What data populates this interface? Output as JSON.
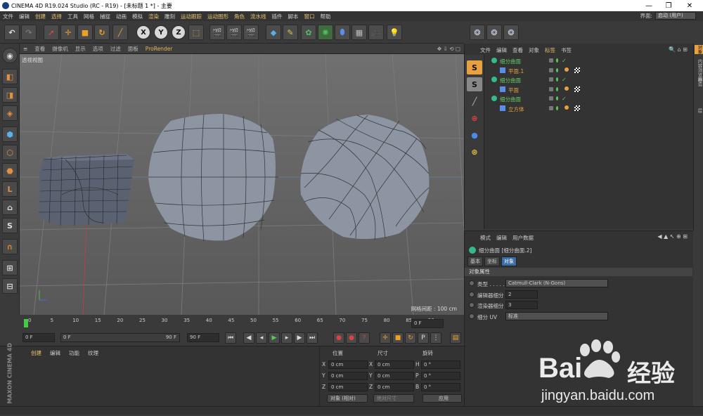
{
  "window": {
    "title": "CINEMA 4D R19.024 Studio (RC - R19) - [未标题 1 *] - 主要"
  },
  "window_controls": {
    "minimize": "—",
    "maximize": "❐",
    "close": "✕"
  },
  "menubar": [
    "文件",
    "编辑",
    "创建",
    "选择",
    "工具",
    "网格",
    "捕捉",
    "动画",
    "模拟",
    "渲染",
    "雕刻",
    "运动跟踪",
    "运动图形",
    "角色",
    "流水线",
    "插件",
    "脚本",
    "窗口",
    "帮助"
  ],
  "layout": {
    "label": "界面:",
    "value": "启动 (用户)"
  },
  "toolbar": {
    "axis_x": "X",
    "axis_y": "Y",
    "axis_z": "Z"
  },
  "viewport": {
    "menu": [
      "查看",
      "摄像机",
      "显示",
      "选项",
      "过滤",
      "面板",
      "ProRender"
    ],
    "title": "透视视图",
    "grid_label": "网格间距 : 100 cm"
  },
  "timeline": {
    "ticks": [
      "0",
      "5",
      "10",
      "15",
      "20",
      "25",
      "30",
      "35",
      "40",
      "45",
      "50",
      "55",
      "60",
      "65",
      "70",
      "75",
      "80",
      "85",
      "90"
    ],
    "frame_field": "0 F",
    "start_field": "0 F",
    "min_field": "0 F",
    "max_field": "90 F",
    "end_field": "90 F"
  },
  "materials": {
    "menu": [
      "创建",
      "编辑",
      "功能",
      "纹理"
    ]
  },
  "coords": {
    "headers": [
      "位置",
      "尺寸",
      "旋转"
    ],
    "rows": [
      {
        "pos_label": "X",
        "pos": "0 cm",
        "size_label": "X",
        "size": "0 cm",
        "rot_label": "H",
        "rot": "0 °"
      },
      {
        "pos_label": "Y",
        "pos": "0 cm",
        "size_label": "Y",
        "size": "0 cm",
        "rot_label": "P",
        "rot": "0 °"
      },
      {
        "pos_label": "Z",
        "pos": "0 cm",
        "size_label": "Z",
        "size": "0 cm",
        "rot_label": "B",
        "rot": "0 °"
      }
    ],
    "mode_select": "对象 (相对)",
    "size_select": "绝对尺寸",
    "apply_button": "应用"
  },
  "brand": {
    "maxon": "MAXON CINEMA 4D"
  },
  "object_manager": {
    "menu": [
      "文件",
      "编辑",
      "查看",
      "对象",
      "标签",
      "书签"
    ],
    "objects": [
      {
        "name": "细分曲面",
        "level": 0
      },
      {
        "name": "平面.1",
        "level": 1
      },
      {
        "name": "细分曲面",
        "level": 0
      },
      {
        "name": "平面",
        "level": 1
      },
      {
        "name": "细分曲面",
        "level": 0
      },
      {
        "name": "立方体",
        "level": 1
      }
    ]
  },
  "right_tabs": [
    "对象",
    "内容浏览器",
    "构造",
    "层"
  ],
  "attributes": {
    "menu": [
      "模式",
      "编辑",
      "用户数据"
    ],
    "object_name": "细分曲面 [细分曲面.2]",
    "tabs": [
      "基本",
      "坐标",
      "对象"
    ],
    "section": "对象属性",
    "rows": [
      {
        "label": "类型 . . . . . . .",
        "value": "Catmull-Clark (N-Gons)"
      },
      {
        "label": "编辑器细分",
        "value": "2"
      },
      {
        "label": "渲染器细分",
        "value": "3"
      },
      {
        "label": "细分 UV",
        "value": "标准"
      }
    ]
  },
  "watermark": {
    "brand": "Bai",
    "brand2": "经验",
    "url": "jingyan.baidu.com"
  }
}
